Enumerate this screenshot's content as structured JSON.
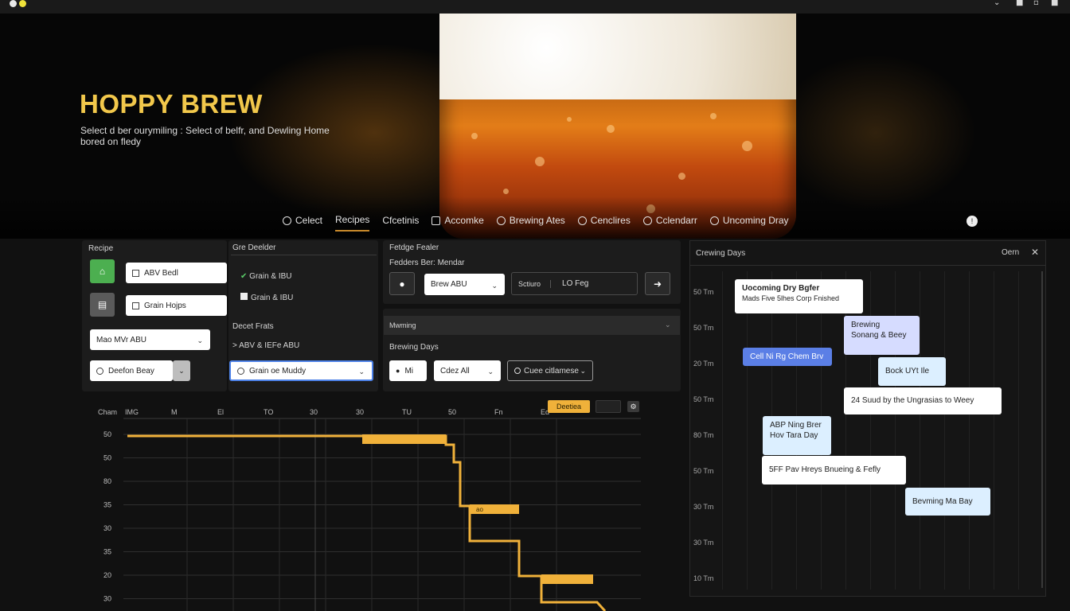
{
  "brand": {
    "title": "HOPPY BREW",
    "tagline": "Select d ber ourymiling : Select of belfr, and Dewling Home bored on fledy"
  },
  "nav": {
    "items": [
      {
        "label": "Celect",
        "icon": "circle-icon"
      },
      {
        "label": "Recipes",
        "active": true
      },
      {
        "label": "Cfcetinis"
      },
      {
        "label": "Accomke",
        "icon": "square-icon"
      },
      {
        "label": "Brewing Ates",
        "icon": "circle-icon"
      },
      {
        "label": "Cenclires",
        "icon": "circle-icon"
      },
      {
        "label": "Cclendarr",
        "icon": "circle-icon"
      },
      {
        "label": "Uncoming Dray",
        "icon": "circle-icon"
      }
    ]
  },
  "recipe_panel": {
    "title": "Recipe",
    "field1": "ABV Bedl",
    "field2": "Grain Hojps",
    "select1": "Mao MVr ABU",
    "select2": "Deefon Beay"
  },
  "grain_panel": {
    "title": "Gre Deelder",
    "check1": "Grain & IBU",
    "check2": "Grain & IBU",
    "subtitle": "Decet Frats",
    "sub_item": "> ABV & IEFe ABU",
    "search": "Grain oe Muddy"
  },
  "filter_panel": {
    "title": "Fetdge Fealer",
    "subtitle": "Fedders Ber: Mendar",
    "select": "Brew ABU",
    "field_label": "Sctiuro",
    "field_value": "LO Feg"
  },
  "brewing_panel": {
    "header": "Mwming",
    "title": "Brewing Days",
    "btn1": "Mi",
    "select1": "Cdez All",
    "select2": "Cuee citlamese"
  },
  "chart": {
    "corner_label": "Cham",
    "x_labels": [
      "IMG",
      "M",
      "El",
      "TO",
      "30",
      "30",
      "TU",
      "50",
      "Fn",
      "Ed"
    ],
    "legend_btn": "Deetiea",
    "y_labels": [
      "50",
      "50",
      "80",
      "35",
      "30",
      "35",
      "20",
      "30"
    ],
    "bar_label": "ao",
    "accent": "#f0b13a"
  },
  "chart_data": {
    "type": "line",
    "title": "",
    "xlabel": "",
    "ylabel": "",
    "series": [
      {
        "values": [
          40,
          40,
          40,
          39,
          37,
          32,
          28,
          24,
          21
        ]
      }
    ]
  },
  "calendar": {
    "title": "Crewing Days",
    "done": "Oern",
    "y_labels": [
      "50 Tm",
      "50 Tm",
      "20 Tm",
      "50 Tm",
      "80 Tm",
      "50 Tm",
      "30 Tm",
      "30 Tm",
      "10 Tm"
    ],
    "events": [
      {
        "title": "Uocoming Dry Bgfer",
        "sub": "Mads Five 5lhes Corp Fnished",
        "style": "white"
      },
      {
        "title": "Brewing",
        "sub": "Sonang & Beey",
        "style": "lavender"
      },
      {
        "title": "Cell Ni Rg Chem Brv",
        "style": "blue"
      },
      {
        "title": "Bock UYt Ile",
        "style": "light"
      },
      {
        "title": "24 Suud by the Ungrasias to Weey",
        "style": "white"
      },
      {
        "title": "ABP Ning Brer",
        "sub": "Hov Tara Day",
        "style": "light"
      },
      {
        "title": "5FF Pav Hreys Bnueing & Fefly",
        "style": "white"
      },
      {
        "title": "Bevming Ma Bay",
        "style": "light"
      }
    ]
  },
  "colors": {
    "accent": "#f2c84b",
    "green": "#4caf50",
    "blue_event": "#5b7fe6"
  }
}
